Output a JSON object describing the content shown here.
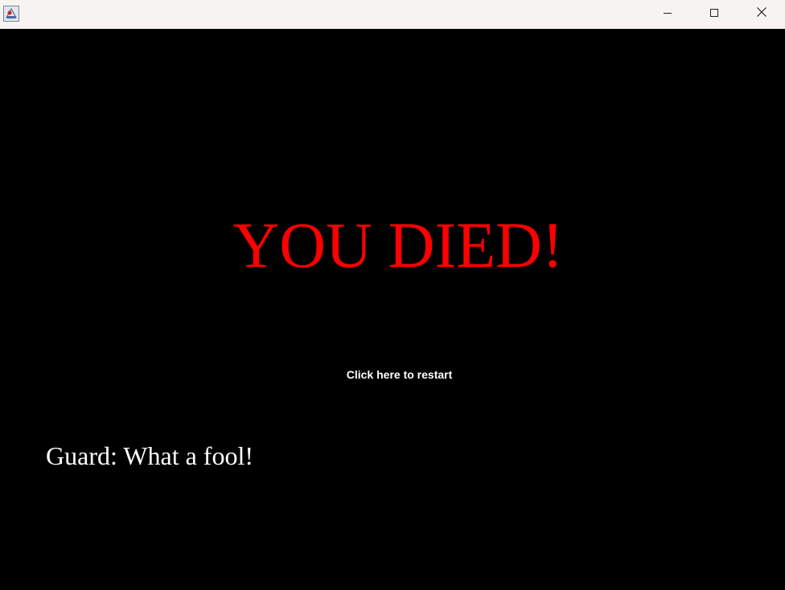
{
  "window": {
    "icon": "java-app-icon",
    "controls": {
      "minimize_icon": "minimize-icon",
      "maximize_icon": "maximize-icon",
      "close_icon": "close-icon"
    }
  },
  "game_over": {
    "title": "YOU DIED!",
    "title_color": "#ff0000",
    "restart_label": "Click here to restart",
    "dialogue": "Guard: What a fool!"
  },
  "colors": {
    "background": "#000000",
    "titlebar": "#f6f3f0",
    "text": "#ffffff"
  }
}
